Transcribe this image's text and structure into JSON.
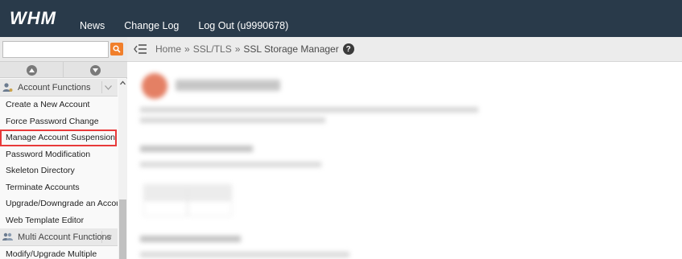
{
  "header": {
    "logo_text": "WHM",
    "nav": [
      "News",
      "Change Log",
      "Log Out (u9990678)"
    ]
  },
  "search": {
    "placeholder": "",
    "value": ""
  },
  "breadcrumb": {
    "items": [
      "Home",
      "SSL/TLS",
      "SSL Storage Manager"
    ],
    "separator": "»"
  },
  "sidebar": {
    "groups": [
      {
        "label": "Account Functions",
        "items": [
          "Create a New Account",
          "Force Password Change",
          "Manage Account Suspension",
          "Password Modification",
          "Skeleton Directory",
          "Terminate Accounts",
          "Upgrade/Downgrade an Account",
          "Web Template Editor"
        ]
      },
      {
        "label": "Multi Account Functions",
        "items": [
          "Modify/Upgrade Multiple"
        ]
      }
    ]
  },
  "colors": {
    "header_bg": "#293a4a",
    "search_button": "#f17f2b",
    "highlight_outline": "#e83a3a"
  }
}
